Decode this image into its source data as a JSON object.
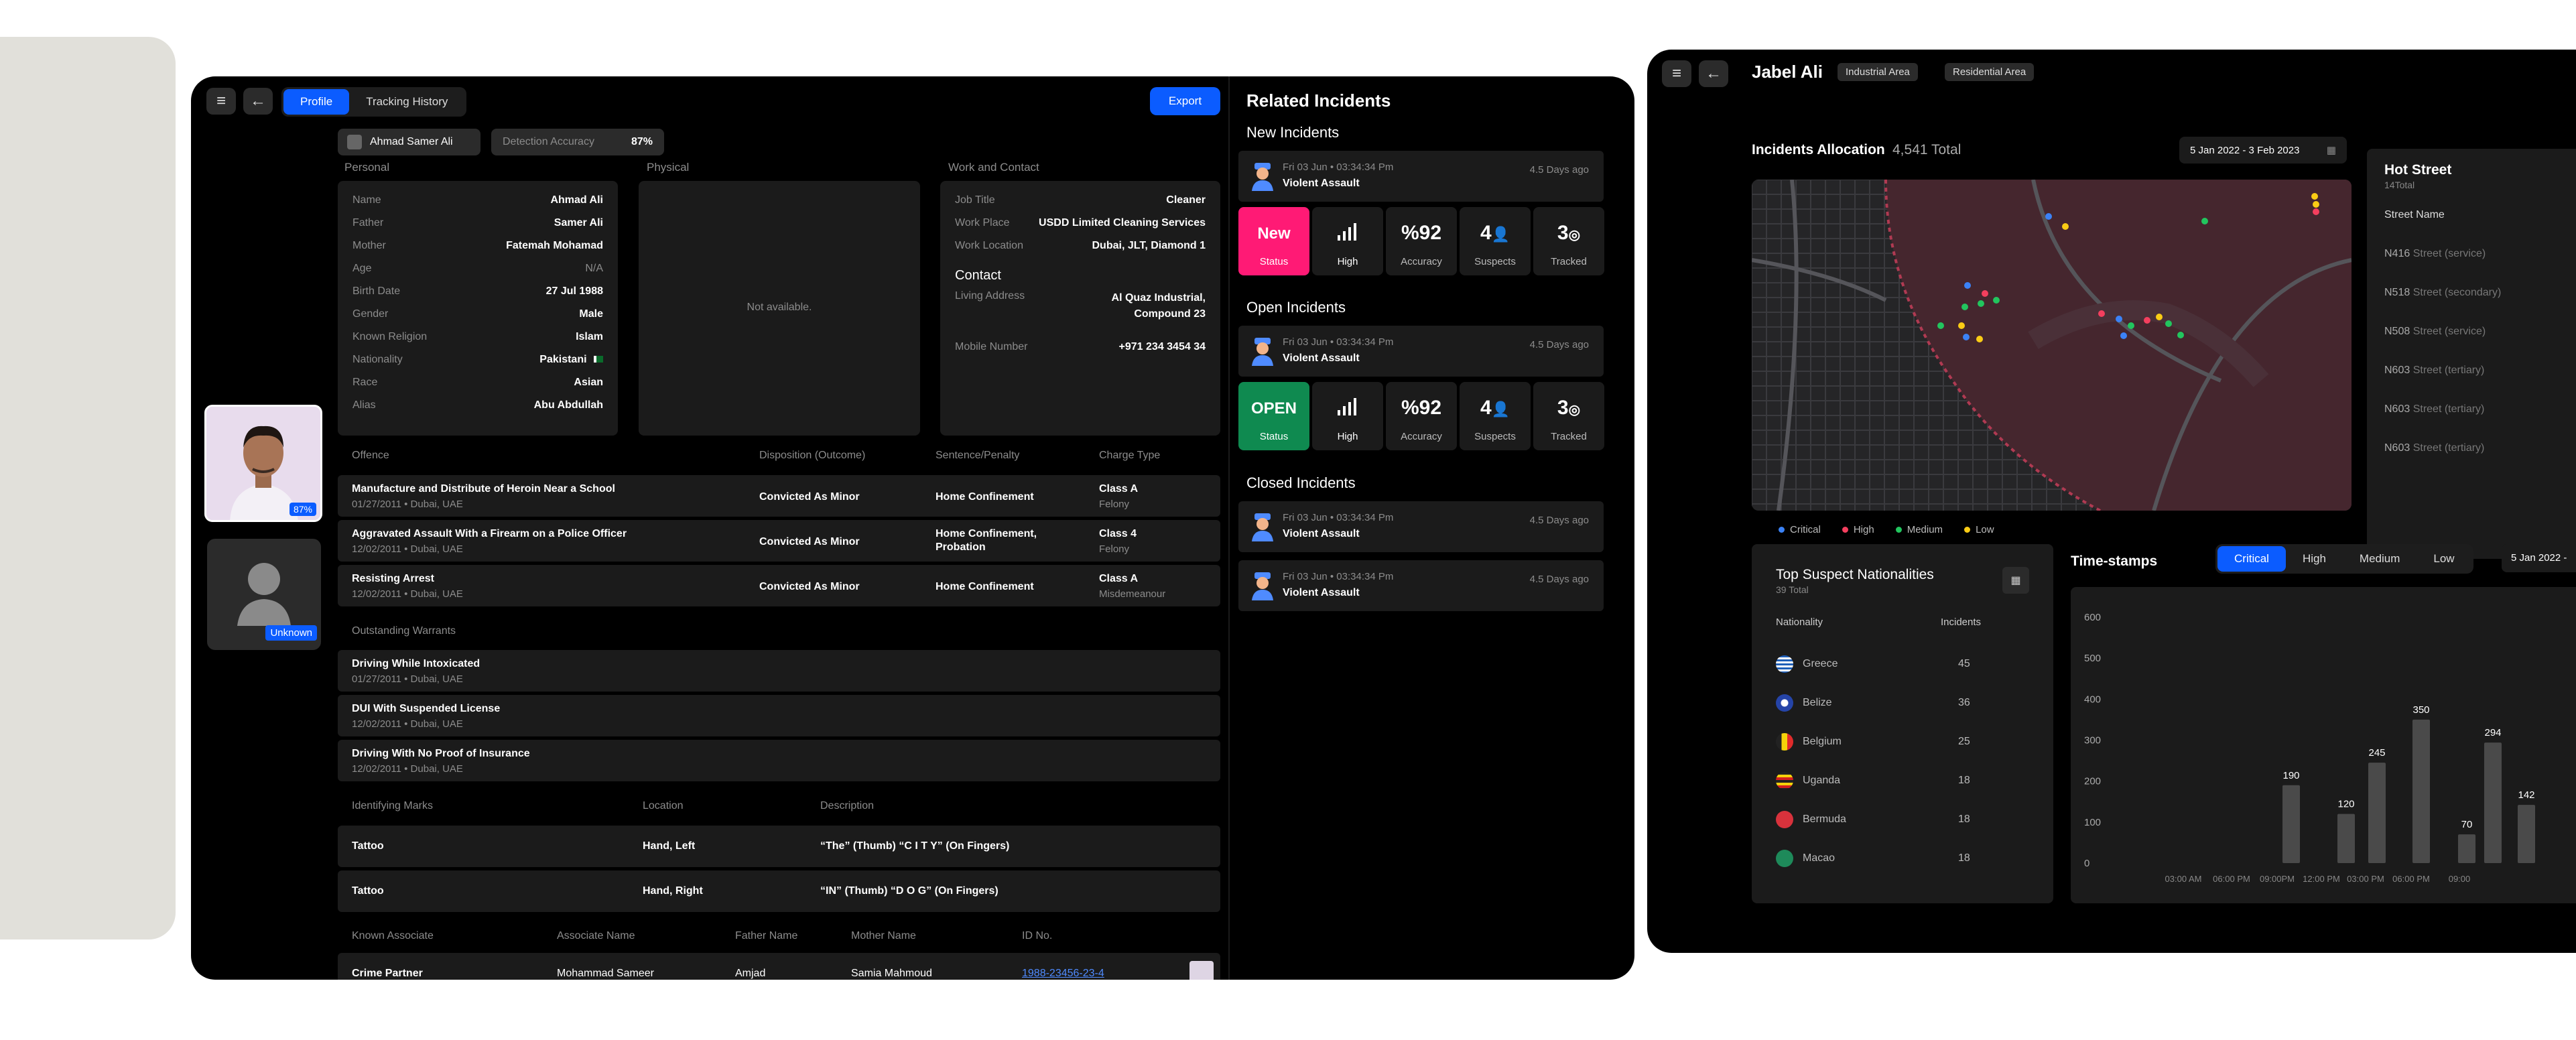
{
  "profile": {
    "tabs": [
      {
        "label": "Profile",
        "active": true
      },
      {
        "label": "Tracking History",
        "active": false
      }
    ],
    "export_label": "Export",
    "person_name": "Ahmad Samer Ali",
    "detection_label": "Detection Accuracy",
    "detection_value": "87%",
    "photo_badge": "87%",
    "unknown_badge": "Unknown",
    "sections": {
      "personal": "Personal",
      "physical": "Physical",
      "work": "Work and Contact",
      "contact": "Contact"
    },
    "personal": [
      {
        "k": "Name",
        "v": "Ahmad Ali"
      },
      {
        "k": "Father",
        "v": "Samer Ali"
      },
      {
        "k": "Mother",
        "v": "Fatemah Mohamad"
      },
      {
        "k": "Age",
        "v": "N/A"
      },
      {
        "k": "Birth Date",
        "v": "27 Jul 1988"
      },
      {
        "k": "Gender",
        "v": "Male"
      },
      {
        "k": "Known Religion",
        "v": "Islam"
      },
      {
        "k": "Nationality",
        "v": "Pakistani"
      },
      {
        "k": "Race",
        "v": "Asian"
      },
      {
        "k": "Alias",
        "v": "Abu Abdullah"
      }
    ],
    "physical_empty": "Not available.",
    "work": [
      {
        "k": "Job Title",
        "v": "Cleaner"
      },
      {
        "k": "Work Place",
        "v": "USDD Limited Cleaning Services"
      },
      {
        "k": "Work Location",
        "v": "Dubai, JLT, Diamond 1"
      }
    ],
    "contact": {
      "address_label": "Living Address",
      "address_line1": "Al Quaz Industrial,",
      "address_line2": "Compound 23",
      "mobile_label": "Mobile Number",
      "mobile": "+971 234 3454 34"
    },
    "offence_headers": {
      "offence": "Offence",
      "disposition": "Disposition (Outcome)",
      "sentence": "Sentence/Penalty",
      "charge": "Charge Type"
    },
    "offences": [
      {
        "title": "Manufacture and Distribute of Heroin Near a School",
        "sub": "01/27/2011 •  Dubai, UAE",
        "disposition": "Convicted As Minor",
        "sentence1": "Home Confinement",
        "sentence2": "",
        "charge": "Class A",
        "charge_sub": "Felony"
      },
      {
        "title": "Aggravated Assault With a Firearm on a Police Officer",
        "sub": "12/02/2011 •  Dubai, UAE",
        "disposition": "Convicted As Minor",
        "sentence1": "Home Confinement,",
        "sentence2": "Probation",
        "charge": "Class 4",
        "charge_sub": "Felony"
      },
      {
        "title": "Resisting Arrest",
        "sub": "12/02/2011 •  Dubai, UAE",
        "disposition": "Convicted As Minor",
        "sentence1": "Home Confinement",
        "sentence2": "",
        "charge": "Class A",
        "charge_sub": "Misdemeanour"
      }
    ],
    "warrants_label": "Outstanding Warrants",
    "warrants": [
      {
        "title": "Driving While Intoxicated",
        "sub": "01/27/2011 •  Dubai, UAE"
      },
      {
        "title": "DUI With Suspended License",
        "sub": "12/02/2011 •  Dubai, UAE"
      },
      {
        "title": "Driving With No Proof of Insurance",
        "sub": "12/02/2011 •  Dubai, UAE"
      }
    ],
    "marks_headers": {
      "marks": "Identifying Marks",
      "location": "Location",
      "description": "Description"
    },
    "marks": [
      {
        "type": "Tattoo",
        "location": "Hand, Left",
        "description": "“The” (Thumb) “C I T Y” (On Fingers)"
      },
      {
        "type": "Tattoo",
        "location": "Hand, Right",
        "description": "“IN” (Thumb) “D O G” (On Fingers)"
      }
    ],
    "assoc_headers": {
      "known": "Known Associate",
      "name": "Associate Name",
      "father": "Father Name",
      "mother": "Mother Name",
      "id": "ID No."
    },
    "associate": {
      "known": "Crime Partner",
      "name": "Mohammad Sameer",
      "father": "Amjad",
      "mother": "Samia Mahmoud",
      "id": "1988-23456-23-4"
    }
  },
  "incidents": {
    "title": "Related Incidents",
    "new_label": "New Incidents",
    "open_label": "Open Incidents",
    "closed_label": "Closed Incidents",
    "item": {
      "date": "Fri 03 Jun • 03:34:34 Pm",
      "type": "Violent Assault",
      "ago": "4.5 Days ago"
    },
    "new_stats": {
      "status": "New",
      "status_label": "Status",
      "level": "High",
      "accuracy": "%92",
      "accuracy_label": "Accuracy",
      "suspects": "4",
      "suspects_label": "Suspects",
      "tracked": "3",
      "tracked_label": "Tracked"
    },
    "open_stats": {
      "status": "OPEN",
      "status_label": "Status",
      "level": "High",
      "accuracy": "%92",
      "accuracy_label": "Accuracy",
      "suspects": "4",
      "suspects_label": "Suspects",
      "tracked": "3",
      "tracked_label": "Tracked"
    }
  },
  "area": {
    "title": "Jabel Ali",
    "tags": [
      "Industrial Area",
      "Residential Area"
    ],
    "alloc_title": "Incidents Allocation",
    "alloc_total": "4,541 Total",
    "date_range": "5 Jan 2022 - 3 Feb 2023",
    "legend": [
      {
        "label": "Critical",
        "color": "#3b82f6"
      },
      {
        "label": "High",
        "color": "#f43f5e"
      },
      {
        "label": "Medium",
        "color": "#22c55e"
      },
      {
        "label": "Low",
        "color": "#facc15"
      }
    ],
    "hot_title": "Hot Street",
    "hot_total": "14Total",
    "street_header": "Street Name",
    "streets": [
      {
        "code": "N416",
        "type": " Street (service)"
      },
      {
        "code": "N518",
        "type": " Street (secondary)"
      },
      {
        "code": "N508",
        "type": " Street (service)"
      },
      {
        "code": "N603",
        "type": " Street (tertiary)"
      },
      {
        "code": "N603",
        "type": " Street (tertiary)"
      },
      {
        "code": "N603",
        "type": " Street (tertiary)"
      }
    ],
    "nat_title": "Top Suspect Nationalities",
    "nat_total": "39 Total",
    "nat_headers": {
      "nationality": "Nationality",
      "incidents": "Incidents"
    },
    "nationalities": [
      {
        "name": "Greece",
        "count": "45"
      },
      {
        "name": "Belize",
        "count": "36"
      },
      {
        "name": "Belgium",
        "count": "25"
      },
      {
        "name": "Uganda",
        "count": "18"
      },
      {
        "name": "Bermuda",
        "count": "18"
      },
      {
        "name": "Macao",
        "count": "18"
      }
    ],
    "ts_title": "Time-stamps",
    "ts_tabs": [
      {
        "label": "Critical",
        "active": true
      },
      {
        "label": "High",
        "active": false
      },
      {
        "label": "Medium",
        "active": false
      },
      {
        "label": "Low",
        "active": false
      }
    ],
    "ts_date": "5 Jan 2022 -"
  },
  "chart_data": {
    "type": "bar",
    "title": "Time-stamps",
    "ylim": [
      0,
      600
    ],
    "yticks": [
      0,
      100,
      200,
      300,
      400,
      500,
      600
    ],
    "xticks": [
      "03:00 AM",
      "06:00 PM",
      "09:00PM",
      "12:00 PM",
      "03:00 PM",
      "06:00 PM",
      "09:00"
    ],
    "bars": [
      {
        "x": "03:00 AM",
        "value": 0,
        "label": ""
      },
      {
        "x": "06:00 PM",
        "value": 190,
        "label": "190"
      },
      {
        "x": "09:00PM",
        "value": 120,
        "label": "120"
      },
      {
        "x": "12:00 PM",
        "value": 245,
        "label": "245"
      },
      {
        "x": "12:00 PM",
        "value": 350,
        "label": "350"
      },
      {
        "x": "03:00 PM",
        "value": 70,
        "label": "70"
      },
      {
        "x": "06:00 PM",
        "value": 294,
        "label": "294"
      },
      {
        "x": "06:00 PM",
        "value": 142,
        "label": "142"
      }
    ]
  }
}
